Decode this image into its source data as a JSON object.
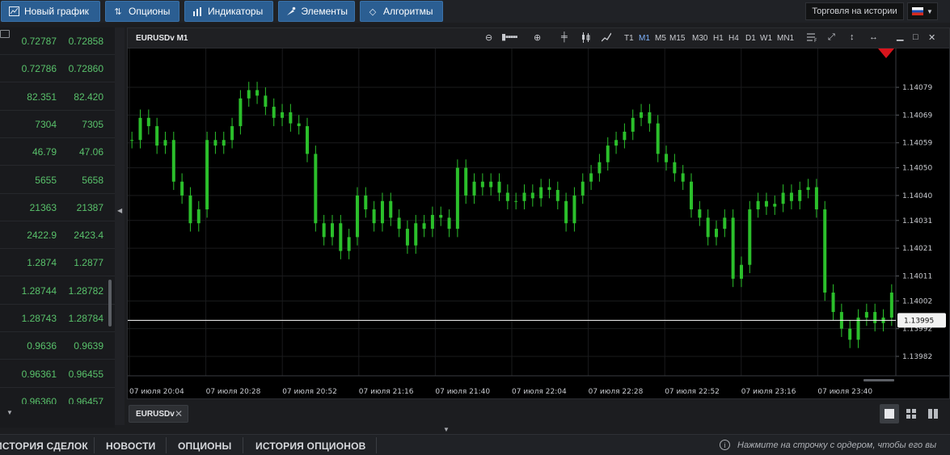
{
  "toolbar": {
    "buttons": [
      {
        "label": "Новый график",
        "icon": "new-chart-icon"
      },
      {
        "label": "Опционы",
        "icon": "options-icon"
      },
      {
        "label": "Индикаторы",
        "icon": "indicators-icon"
      },
      {
        "label": "Элементы",
        "icon": "elements-icon"
      },
      {
        "label": "Алгоритмы",
        "icon": "algorithms-icon"
      }
    ],
    "history_trading_label": "Торговля на истории",
    "language": "ru"
  },
  "quotes": [
    {
      "bid": "0.72787",
      "ask": "0.72858"
    },
    {
      "bid": "0.72786",
      "ask": "0.72860"
    },
    {
      "bid": "82.351",
      "ask": "82.420"
    },
    {
      "bid": "7304",
      "ask": "7305"
    },
    {
      "bid": "46.79",
      "ask": "47.06"
    },
    {
      "bid": "5655",
      "ask": "5658"
    },
    {
      "bid": "21363",
      "ask": "21387"
    },
    {
      "bid": "2422.9",
      "ask": "2423.4"
    },
    {
      "bid": "1.2874",
      "ask": "1.2877"
    },
    {
      "bid": "1.28744",
      "ask": "1.28782"
    },
    {
      "bid": "1.28743",
      "ask": "1.28784"
    },
    {
      "bid": "0.9636",
      "ask": "0.9639"
    },
    {
      "bid": "0.96361",
      "ask": "0.96455"
    },
    {
      "bid": "0.96360",
      "ask": "0.96457"
    }
  ],
  "chart_window": {
    "title": "EURUSDv M1",
    "timeframes": [
      "T1",
      "M1",
      "M5",
      "M15",
      "M30",
      "H1",
      "H4",
      "D1",
      "W1",
      "MN1"
    ],
    "active_timeframe": "M1"
  },
  "chart_data": {
    "type": "candlestick",
    "symbol": "EURUSDv",
    "timeframe": "M1",
    "price_axis_ticks": [
      "1.14079",
      "1.14069",
      "1.14059",
      "1.14050",
      "1.14040",
      "1.14031",
      "1.14021",
      "1.14011",
      "1.14002",
      "1.13992",
      "1.13982"
    ],
    "current_price": "1.13995",
    "time_axis_ticks": [
      "07 июля 20:04",
      "07 июля 20:28",
      "07 июля 20:52",
      "07 июля 21:16",
      "07 июля 21:40",
      "07 июля 22:04",
      "07 июля 22:28",
      "07 июля 22:52",
      "07 июля 23:16",
      "07 июля 23:40"
    ],
    "ylim": [
      1.13975,
      1.14093
    ],
    "close_series": [
      1.1406,
      1.14068,
      1.14065,
      1.14058,
      1.1406,
      1.14045,
      1.1404,
      1.1403,
      1.14035,
      1.1406,
      1.14058,
      1.1406,
      1.14065,
      1.14075,
      1.14078,
      1.14076,
      1.14072,
      1.14068,
      1.1407,
      1.14066,
      1.14065,
      1.14055,
      1.1403,
      1.14025,
      1.1403,
      1.1402,
      1.14025,
      1.1404,
      1.14035,
      1.1403,
      1.14038,
      1.14032,
      1.14028,
      1.14022,
      1.1403,
      1.14028,
      1.14033,
      1.14032,
      1.14028,
      1.1405,
      1.1404,
      1.14045,
      1.14043,
      1.14045,
      1.14041,
      1.14038,
      1.14038,
      1.14041,
      1.14039,
      1.14043,
      1.14042,
      1.14038,
      1.1403,
      1.1404,
      1.14045,
      1.14048,
      1.14052,
      1.14058,
      1.1406,
      1.14063,
      1.14068,
      1.1407,
      1.14066,
      1.14055,
      1.14052,
      1.14048,
      1.14045,
      1.14035,
      1.14032,
      1.14025,
      1.14028,
      1.14032,
      1.1401,
      1.14015,
      1.14035,
      1.14038,
      1.14036,
      1.14037,
      1.14041,
      1.14038,
      1.14042,
      1.14043,
      1.14035,
      1.14005,
      1.13998,
      1.13992,
      1.13988,
      1.13996,
      1.13998,
      1.13994,
      1.13996,
      1.14005
    ]
  },
  "tabs": [
    {
      "label": "EURUSDv"
    }
  ],
  "bottom_tabs": [
    "ИСТОРИЯ СДЕЛОК",
    "НОВОСТИ",
    "ОПЦИОНЫ",
    "ИСТОРИЯ ОПЦИОНОВ"
  ],
  "status_hint": "Нажмите на строчку с ордером, чтобы его вы"
}
